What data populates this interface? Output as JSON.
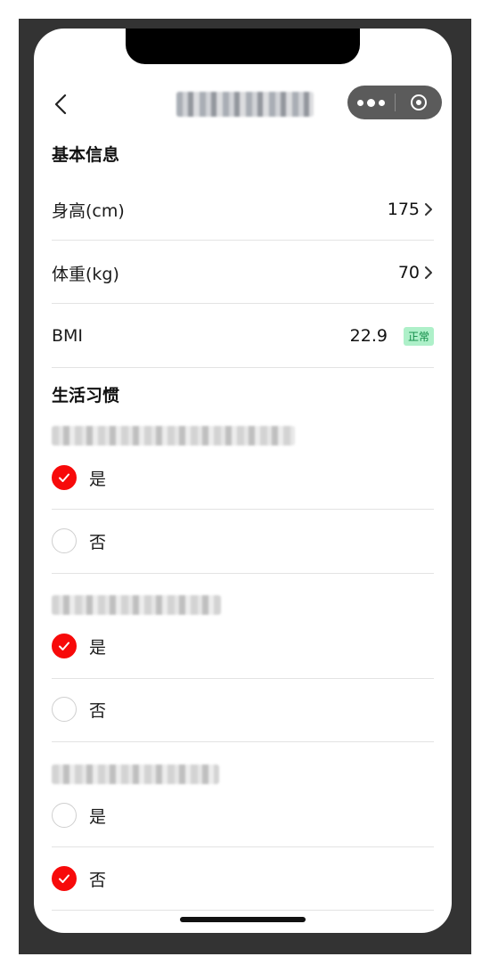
{
  "nav": {
    "back_icon": "chevron-left-icon",
    "title": "",
    "capsule": {
      "more_icon": "more-dots-icon",
      "close_icon": "target-circle-icon"
    }
  },
  "basic": {
    "title": "基本信息",
    "height": {
      "label": "身高(cm)",
      "value": "175"
    },
    "weight": {
      "label": "体重(kg)",
      "value": "70"
    },
    "bmi": {
      "label": "BMI",
      "value": "22.9",
      "status": "正常"
    }
  },
  "life": {
    "title": "生活习惯",
    "questions": [
      {
        "options": [
          {
            "label": "是",
            "selected": true
          },
          {
            "label": "否",
            "selected": false
          }
        ]
      },
      {
        "options": [
          {
            "label": "是",
            "selected": true
          },
          {
            "label": "否",
            "selected": false
          }
        ]
      },
      {
        "options": [
          {
            "label": "是",
            "selected": false
          },
          {
            "label": "否",
            "selected": true
          }
        ]
      }
    ]
  },
  "colors": {
    "accent": "#f70a0a",
    "badge_bg": "#aef0c9",
    "badge_text": "#0f8a45",
    "frame": "#333333"
  }
}
